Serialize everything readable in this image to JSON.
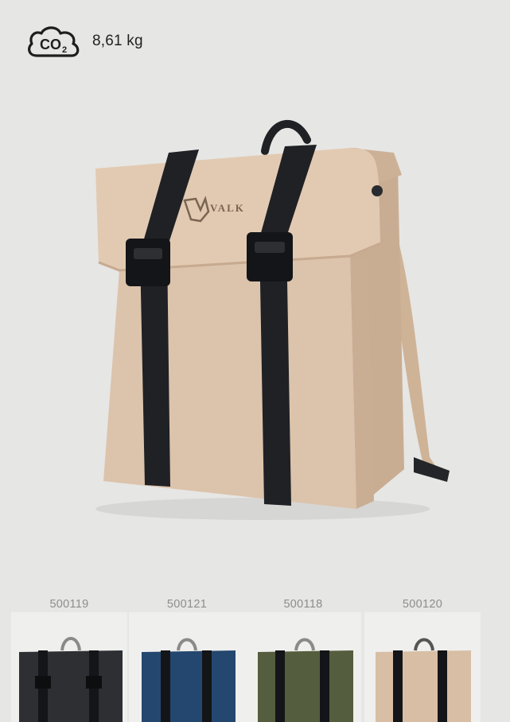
{
  "co2": {
    "icon": "co2-cloud-icon",
    "icon_text": "CO2",
    "value": "8,61 kg"
  },
  "hero": {
    "product": "backpack",
    "brand_logo_text": "VALK",
    "color": "#d8bfa7",
    "strap_color": "#1d1f22"
  },
  "variants": [
    {
      "code": "500119",
      "color": "#2d2f33"
    },
    {
      "code": "500121",
      "color": "#24476f"
    },
    {
      "code": "500118",
      "color": "#545d3d"
    },
    {
      "code": "500120",
      "color": "#d7bea4"
    }
  ]
}
